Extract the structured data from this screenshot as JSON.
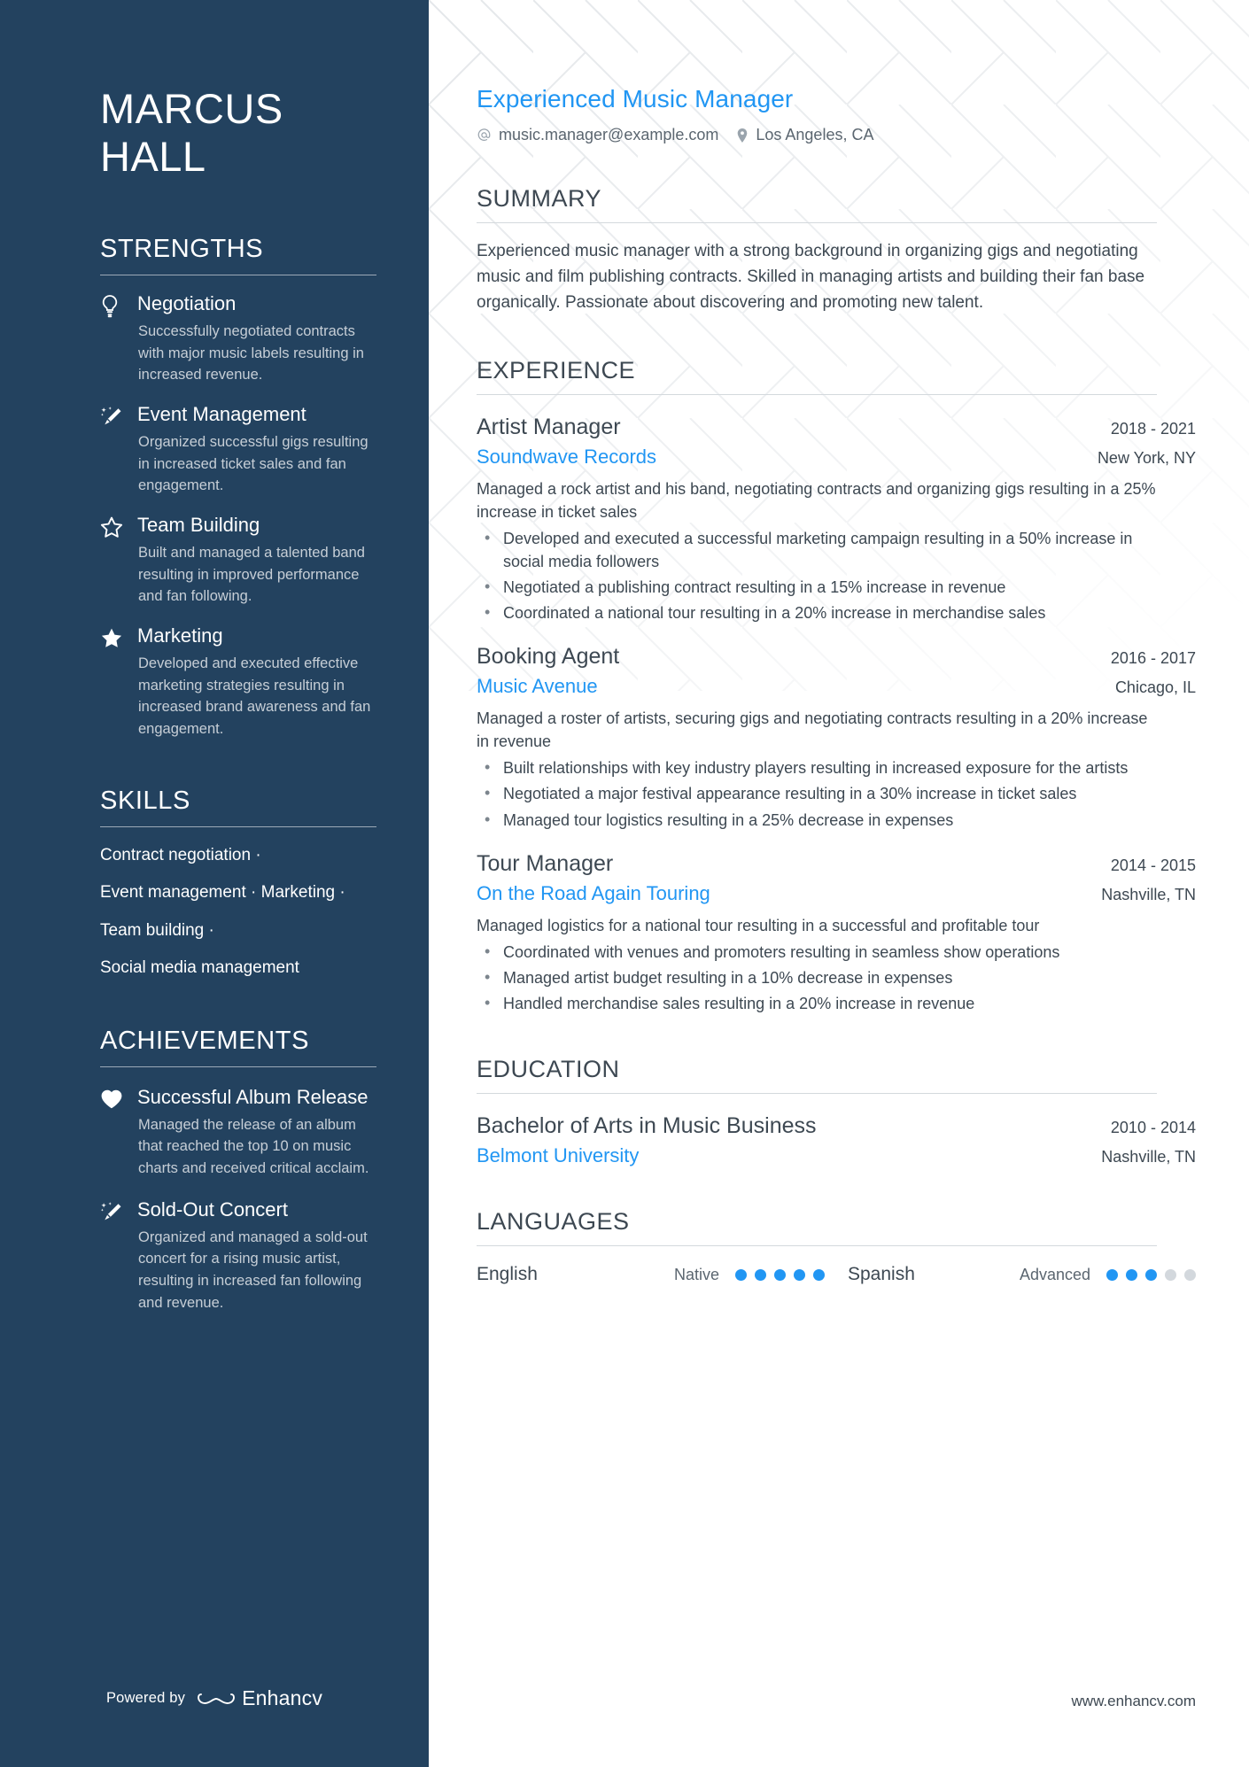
{
  "theme": {
    "sidebar_bg": "#23425f",
    "accent": "#2196f3",
    "text_dark": "#3d4852",
    "muted": "#c6ced6"
  },
  "sidebar": {
    "name_line1": "MARCUS",
    "name_line2": "HALL",
    "strengths": {
      "heading": "STRENGTHS",
      "items": [
        {
          "icon": "lightbulb-icon",
          "title": "Negotiation",
          "description": "Successfully negotiated contracts with major music labels resulting in increased revenue."
        },
        {
          "icon": "magic-wand-icon",
          "title": "Event Management",
          "description": "Organized successful gigs resulting in increased ticket sales and fan engagement."
        },
        {
          "icon": "star-outline-icon",
          "title": "Team Building",
          "description": "Built and managed a talented band resulting in improved performance and fan following."
        },
        {
          "icon": "star-filled-icon",
          "title": "Marketing",
          "description": "Developed and executed effective marketing strategies resulting in increased brand awareness and fan engagement."
        }
      ]
    },
    "skills": {
      "heading": "SKILLS",
      "lines": [
        "Contract negotiation ·",
        "Event management · Marketing ·",
        "Team building ·",
        "Social media management"
      ]
    },
    "achievements": {
      "heading": "ACHIEVEMENTS",
      "items": [
        {
          "icon": "heart-icon",
          "title": "Successful Album Release",
          "description": "Managed the release of an album that reached the top 10 on music charts and received critical acclaim."
        },
        {
          "icon": "magic-wand-icon",
          "title": "Sold-Out Concert",
          "description": "Organized and managed a sold-out concert for a rising music artist, resulting in increased fan following and revenue."
        }
      ]
    },
    "footer": {
      "powered_by": "Powered by",
      "brand": "Enhancv"
    }
  },
  "main": {
    "headline": "Experienced Music Manager",
    "contact": {
      "email_icon": "at-sign-icon",
      "email": "music.manager@example.com",
      "location_icon": "map-pin-icon",
      "location": "Los Angeles, CA"
    },
    "summary": {
      "heading": "SUMMARY",
      "text": "Experienced music manager with a strong background in organizing gigs and negotiating music and film publishing contracts. Skilled in managing artists and building their fan base organically. Passionate about discovering and promoting new talent."
    },
    "experience": {
      "heading": "EXPERIENCE",
      "entries": [
        {
          "title": "Artist Manager",
          "dates": "2018 - 2021",
          "organization": "Soundwave Records",
          "location": "New York, NY",
          "description": "Managed a rock artist and his band, negotiating contracts and organizing gigs resulting in a 25% increase in ticket sales",
          "bullets": [
            "Developed and executed a successful marketing campaign resulting in a 50% increase in social media followers",
            "Negotiated a publishing contract resulting in a 15% increase in revenue",
            "Coordinated a national tour resulting in a 20% increase in merchandise sales"
          ]
        },
        {
          "title": "Booking Agent",
          "dates": "2016 - 2017",
          "organization": "Music Avenue",
          "location": "Chicago, IL",
          "description": "Managed a roster of artists, securing gigs and negotiating contracts resulting in a 20% increase in revenue",
          "bullets": [
            "Built relationships with key industry players resulting in increased exposure for the artists",
            "Negotiated a major festival appearance resulting in a 30% increase in ticket sales",
            "Managed tour logistics resulting in a 25% decrease in expenses"
          ]
        },
        {
          "title": "Tour Manager",
          "dates": "2014 - 2015",
          "organization": "On the Road Again Touring",
          "location": "Nashville, TN",
          "description": "Managed logistics for a national tour resulting in a successful and profitable tour",
          "bullets": [
            "Coordinated with venues and promoters resulting in seamless show operations",
            "Managed artist budget resulting in a 10% decrease in expenses",
            "Handled merchandise sales resulting in a 20% increase in revenue"
          ]
        }
      ]
    },
    "education": {
      "heading": "EDUCATION",
      "entries": [
        {
          "title": "Bachelor of Arts in Music Business",
          "dates": "2010 - 2014",
          "organization": "Belmont University",
          "location": "Nashville, TN"
        }
      ]
    },
    "languages": {
      "heading": "LANGUAGES",
      "entries": [
        {
          "name": "English",
          "level": "Native",
          "filled": 5,
          "total": 5
        },
        {
          "name": "Spanish",
          "level": "Advanced",
          "filled": 3,
          "total": 5
        }
      ]
    },
    "website": "www.enhancv.com"
  }
}
